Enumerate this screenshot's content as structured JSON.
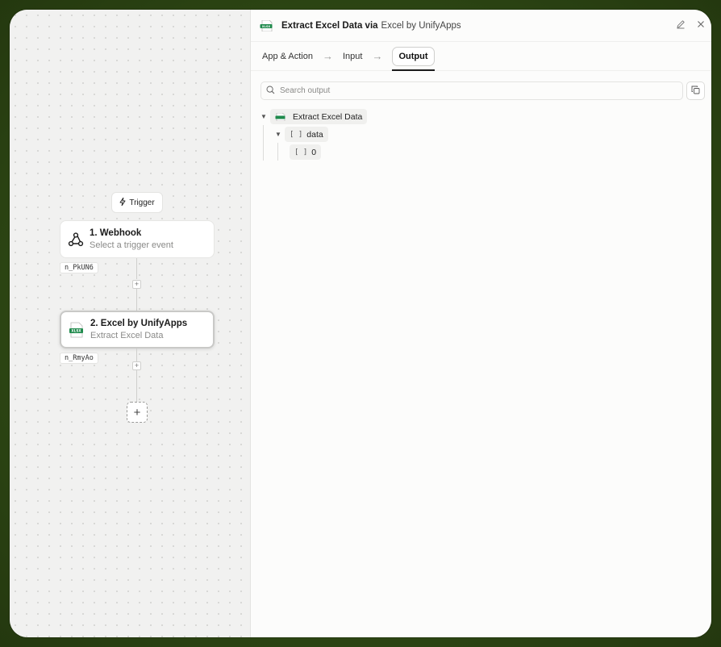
{
  "canvas": {
    "trigger_label": "Trigger",
    "nodes": [
      {
        "title": "1. Webhook",
        "subtitle": "Select a trigger event",
        "id": "n_PkUN6",
        "icon": "webhook-icon"
      },
      {
        "title": "2. Excel by UnifyApps",
        "subtitle": "Extract Excel Data",
        "id": "n_RmyAo",
        "icon": "xlsx-icon",
        "icon_text": "XLSX"
      }
    ],
    "add_step_label": "+"
  },
  "panel": {
    "header": {
      "title": "Extract Excel Data via",
      "app": "Excel by UnifyApps",
      "icon_text": "XLSX"
    },
    "tabs": [
      {
        "label": "App & Action"
      },
      {
        "label": "Input"
      },
      {
        "label": "Output"
      }
    ],
    "active_tab": "Output",
    "search": {
      "placeholder": "Search output",
      "value": ""
    },
    "tree": {
      "root": {
        "label": "Extract Excel Data",
        "icon_text": "XLSX"
      },
      "child": {
        "label": "data",
        "type": "[ ]"
      },
      "grandchild": {
        "label": "0",
        "type": "[ ]"
      }
    }
  },
  "colors": {
    "excel_green": "#1f8a4c",
    "frame_green": "#2f4a15"
  }
}
